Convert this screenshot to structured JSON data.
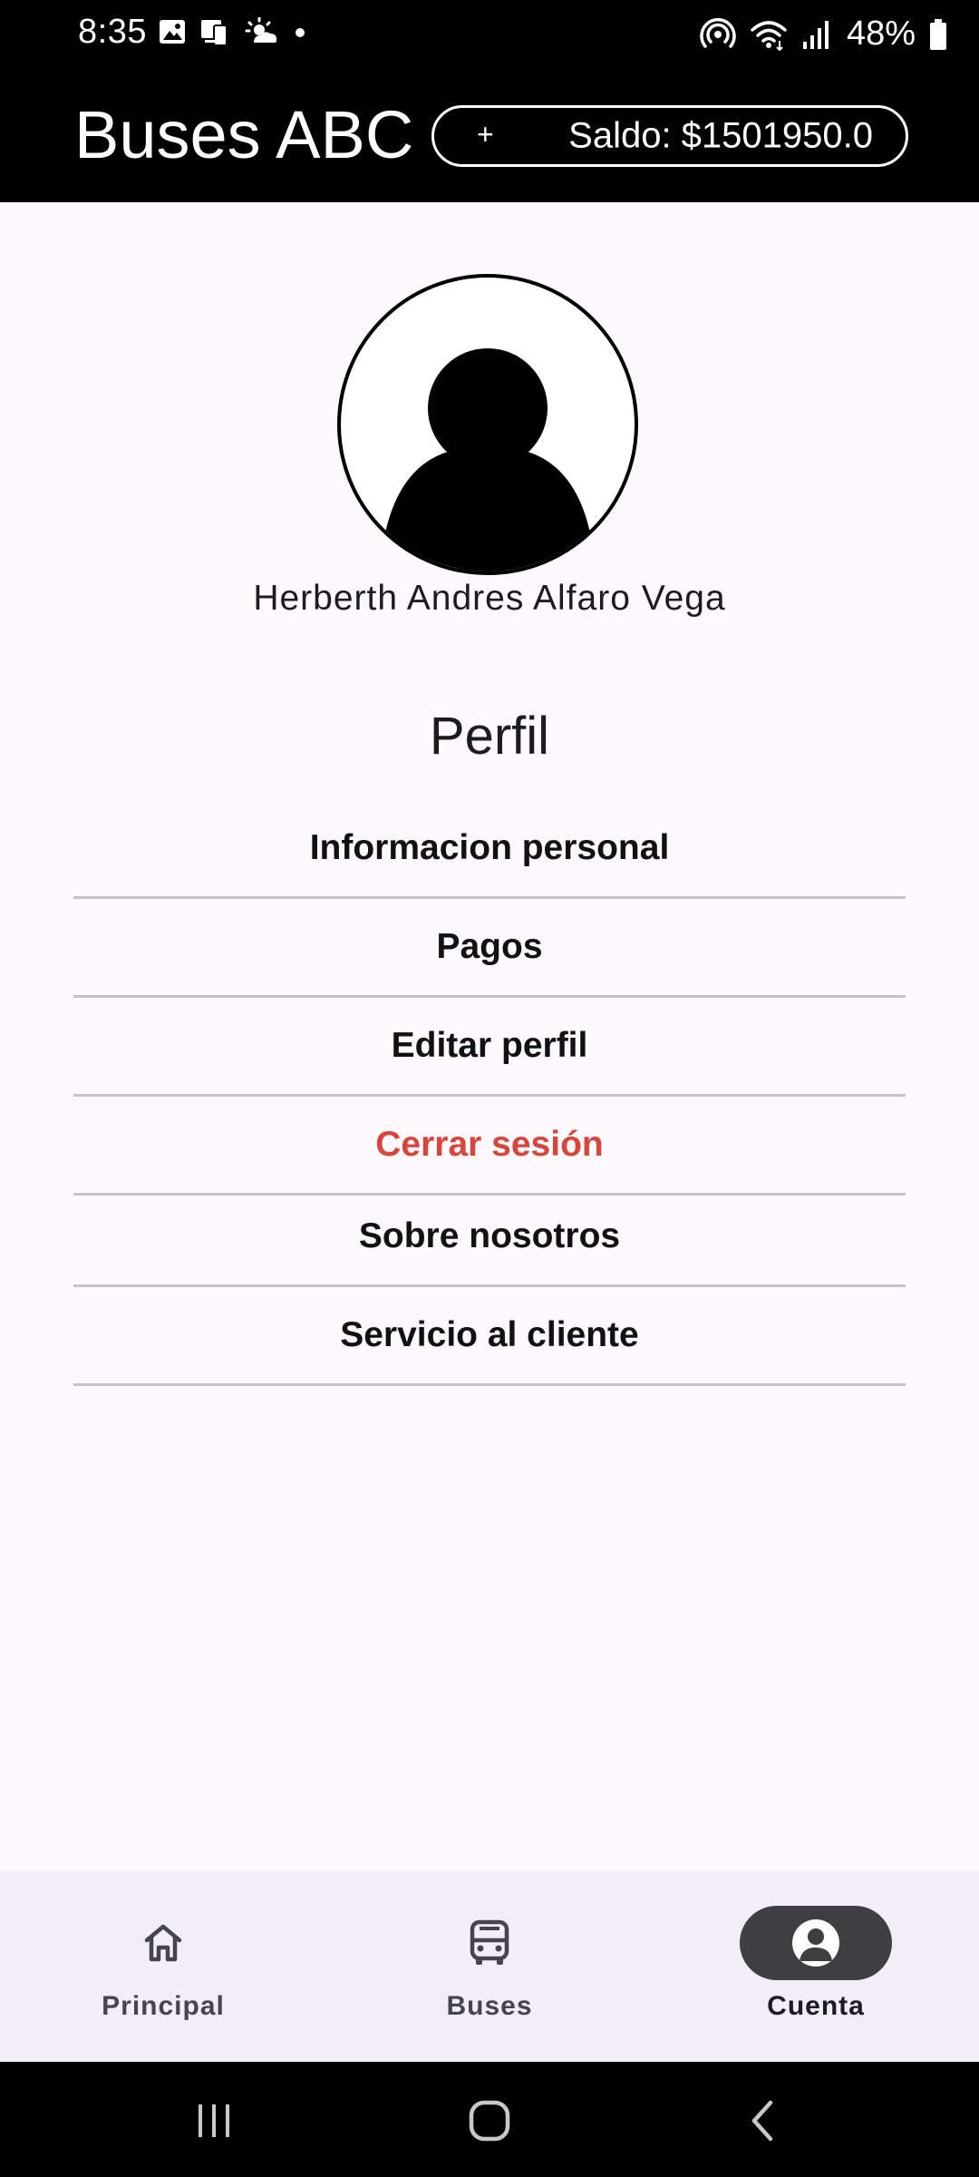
{
  "status_bar": {
    "time": "8:35",
    "battery": "48%",
    "icons": [
      "gallery-icon",
      "device-transfer-icon",
      "weather-sunrise-icon",
      "notification-dot-icon",
      "hotspot-icon",
      "wifi-icon",
      "signal-icon",
      "battery-icon"
    ]
  },
  "app_bar": {
    "title": "Buses ABC",
    "add_symbol": "+",
    "balance": "Saldo: $1501950.0"
  },
  "profile": {
    "name": "Herberth Andres Alfaro Vega",
    "avatar_icon": "person-silhouette-icon"
  },
  "section": {
    "title": "Perfil"
  },
  "menu": [
    {
      "label": "Informacion personal"
    },
    {
      "label": "Pagos"
    },
    {
      "label": "Editar perfil"
    },
    {
      "label": "Cerrar sesión",
      "color": "#d9443b"
    }
  ],
  "menu_secondary": [
    {
      "label": "Sobre nosotros"
    },
    {
      "label": "Servicio al cliente"
    }
  ],
  "bottom_nav": {
    "items": [
      {
        "label": "Principal",
        "icon": "home-icon",
        "active": false
      },
      {
        "label": "Buses",
        "icon": "bus-icon",
        "active": false
      },
      {
        "label": "Cuenta",
        "icon": "account-circle-icon",
        "active": true
      }
    ]
  },
  "system_nav": {
    "icons": [
      "recent-apps-icon",
      "home-button-icon",
      "back-icon"
    ]
  },
  "colors": {
    "app_bar": "#000000",
    "background": "#fdf8fc",
    "bottom_nav": "#f3edf6",
    "active_indicator": "#3f3e42",
    "danger": "#d9443b"
  }
}
